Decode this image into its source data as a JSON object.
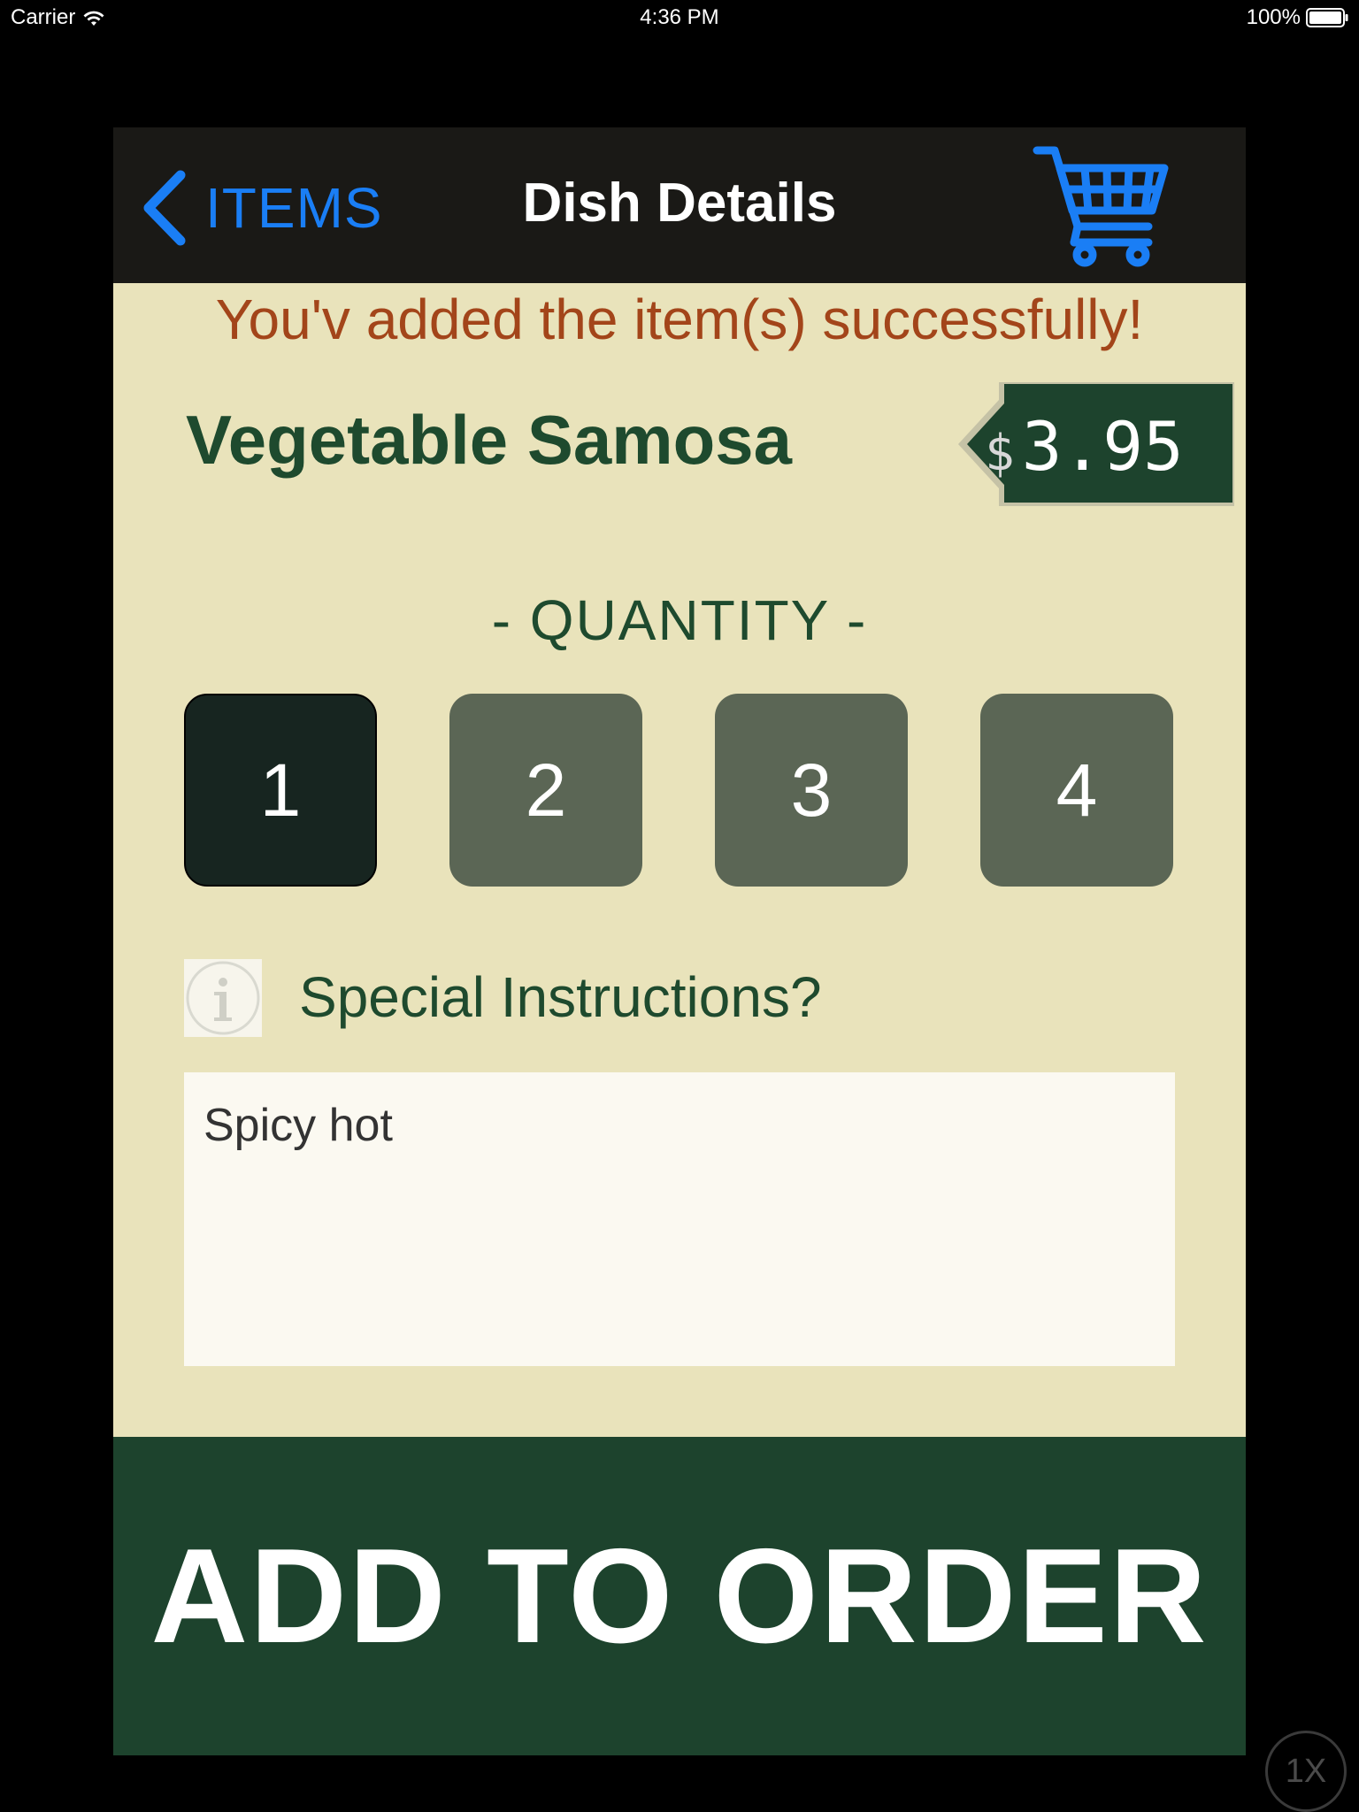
{
  "status_bar": {
    "carrier": "Carrier",
    "time": "4:36 PM",
    "battery": "100%"
  },
  "nav": {
    "back_label": "ITEMS",
    "title": "Dish Details",
    "cart_icon": "shopping-cart-icon",
    "accent_color": "#1a7ef5"
  },
  "notice": {
    "message": "You'v added the item(s) successfully!",
    "color": "#a3451a"
  },
  "dish": {
    "name": "Vegetable Samosa",
    "currency": "$",
    "price": "3.95"
  },
  "quantity": {
    "label": "- QUANTITY -",
    "options": [
      "1",
      "2",
      "3",
      "4"
    ],
    "selected": "1"
  },
  "instructions": {
    "icon": "info-icon",
    "label": "Special Instructions?",
    "value": "Spicy hot"
  },
  "actions": {
    "add_label": "ADD TO ORDER",
    "button_color": "#1d432d"
  },
  "scale_badge": "1X"
}
